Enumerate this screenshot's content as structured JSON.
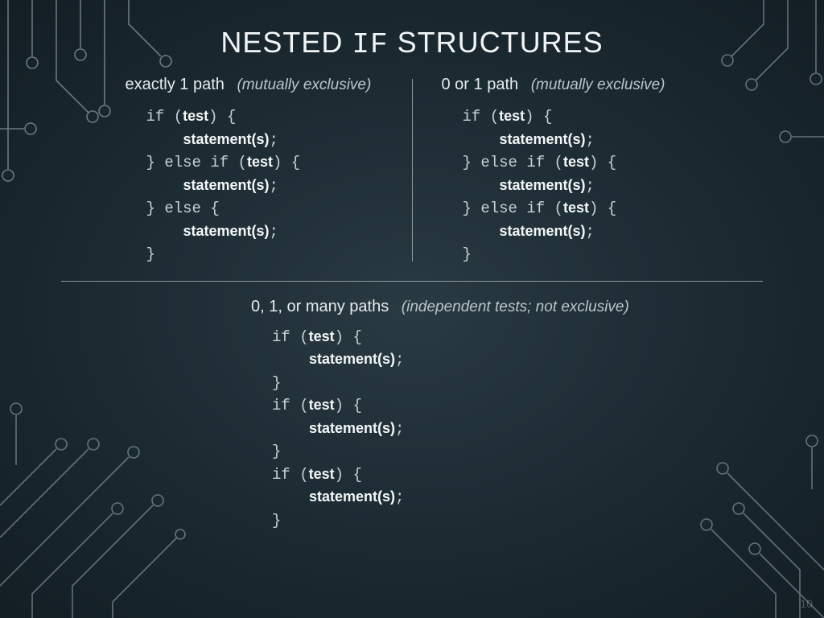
{
  "title_parts": {
    "pre": "NESTED ",
    "mono": "IF",
    "post": " STRUCTURES"
  },
  "sections": {
    "left": {
      "heading": "exactly 1 path",
      "note": "(mutually exclusive)"
    },
    "right": {
      "heading": "0 or 1 path",
      "note": "(mutually exclusive)"
    },
    "bottom": {
      "heading": "0, 1, or many paths",
      "note": "(independent tests; not exclusive)"
    }
  },
  "tokens": {
    "if": "if",
    "elseif": "else if",
    "else": "else",
    "lparen": " (",
    "rparen": ") {",
    "test": "test",
    "stmt": "statement(s)",
    "semi": ";",
    "closeopen": "} ",
    "openelse": " {",
    "close": "}"
  },
  "page_number": "10"
}
